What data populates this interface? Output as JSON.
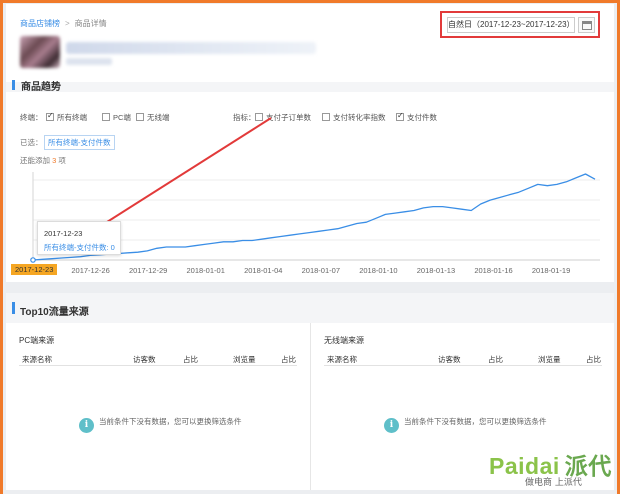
{
  "breadcrumb": {
    "home": "商品店铺榜",
    "sep": ">",
    "current": "商品详情"
  },
  "date_range": {
    "label": "自然日（2017-12-23~2017-12-23）"
  },
  "trend": {
    "title": "商品趋势",
    "terminal_label": "终端：",
    "terminals": [
      {
        "label": "所有终端",
        "checked": true
      },
      {
        "label": "PC端",
        "checked": false
      },
      {
        "label": "无线端",
        "checked": false
      }
    ],
    "metric_label": "指标：",
    "metrics": [
      {
        "label": "支付子订单数",
        "checked": false
      },
      {
        "label": "支付转化率指数",
        "checked": false
      },
      {
        "label": "支付件数",
        "checked": true
      }
    ],
    "chosen_label": "已选：",
    "chosen_tag": "所有终端-支付件数",
    "add_hint_prefix": "还能添加",
    "add_hint_count": "3",
    "add_hint_suffix": "项",
    "tooltip_date": "2017-12-23",
    "tooltip_value": "所有终端-支付件数: 0",
    "accent_color": "#3a8ee6",
    "highlight_color": "#f5a623"
  },
  "chart_data": {
    "type": "line",
    "x_tick_labels": [
      "2017-12-23",
      "2017-12-26",
      "2017-12-29",
      "2018-01-01",
      "2018-01-04",
      "2018-01-07",
      "2018-01-10",
      "2018-01-13",
      "2018-01-16",
      "2018-01-19"
    ],
    "series": [
      {
        "values": [
          0,
          0.5,
          1,
          1.5,
          2,
          2.5,
          3.5,
          4,
          4.5,
          5,
          5.5,
          6,
          7,
          9,
          10,
          10,
          10,
          11,
          12,
          13,
          14,
          14,
          15,
          15,
          16,
          17,
          18,
          19,
          20,
          21,
          22,
          23,
          24,
          26,
          28,
          29,
          32,
          35,
          36,
          37,
          38,
          40,
          41,
          41,
          40,
          39,
          38,
          43,
          46,
          48,
          50,
          52,
          55,
          58,
          57,
          58,
          60,
          63,
          66,
          62
        ]
      }
    ],
    "grid": true
  },
  "top10": {
    "title": "Top10流量来源",
    "pc": {
      "title": "PC端来源"
    },
    "wireless": {
      "title": "无线端来源"
    },
    "columns": [
      "来源名称",
      "访客数",
      "占比",
      "浏览量",
      "占比"
    ],
    "no_data": "当前条件下没有数据，您可以更换筛选条件"
  },
  "watermark": {
    "brand": "Paidai",
    "brand_cn": "派代",
    "sub": "做电商 上派代"
  }
}
